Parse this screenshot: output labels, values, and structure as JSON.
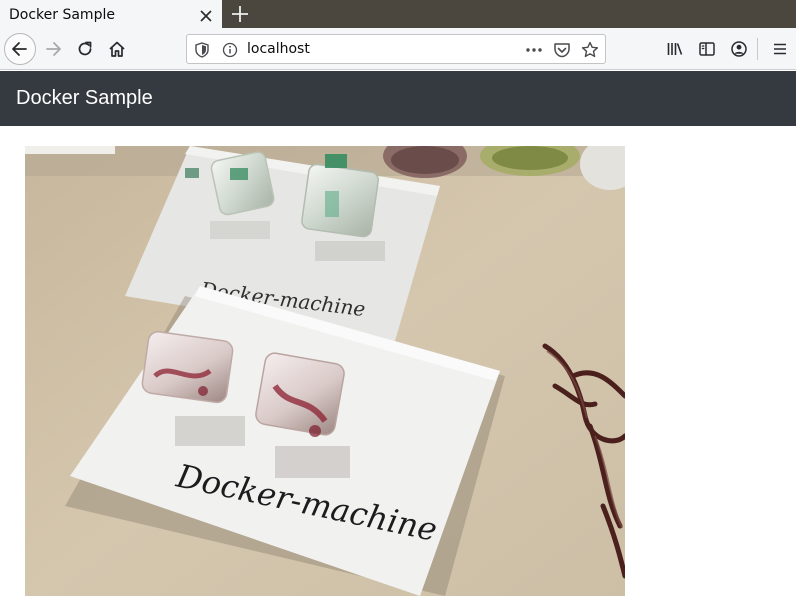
{
  "browser": {
    "tab": {
      "title": "Docker Sample"
    },
    "url": "localhost",
    "icons": {
      "back": "arrow-left-icon",
      "forward": "arrow-right-icon",
      "reload": "reload-icon",
      "home": "home-icon",
      "shield": "shield-icon",
      "info": "info-icon",
      "page_actions": "more-dots-icon",
      "pocket": "pocket-icon",
      "bookmark": "star-icon",
      "library": "library-icon",
      "sidebar": "sidebar-icon",
      "account": "account-icon",
      "menu": "hamburger-menu-icon"
    }
  },
  "page": {
    "header_title": "Docker Sample",
    "header_color": "#343a40",
    "image": {
      "card_text_top": "Docker-machine",
      "card_text_bottom": "Docker-machine"
    }
  }
}
